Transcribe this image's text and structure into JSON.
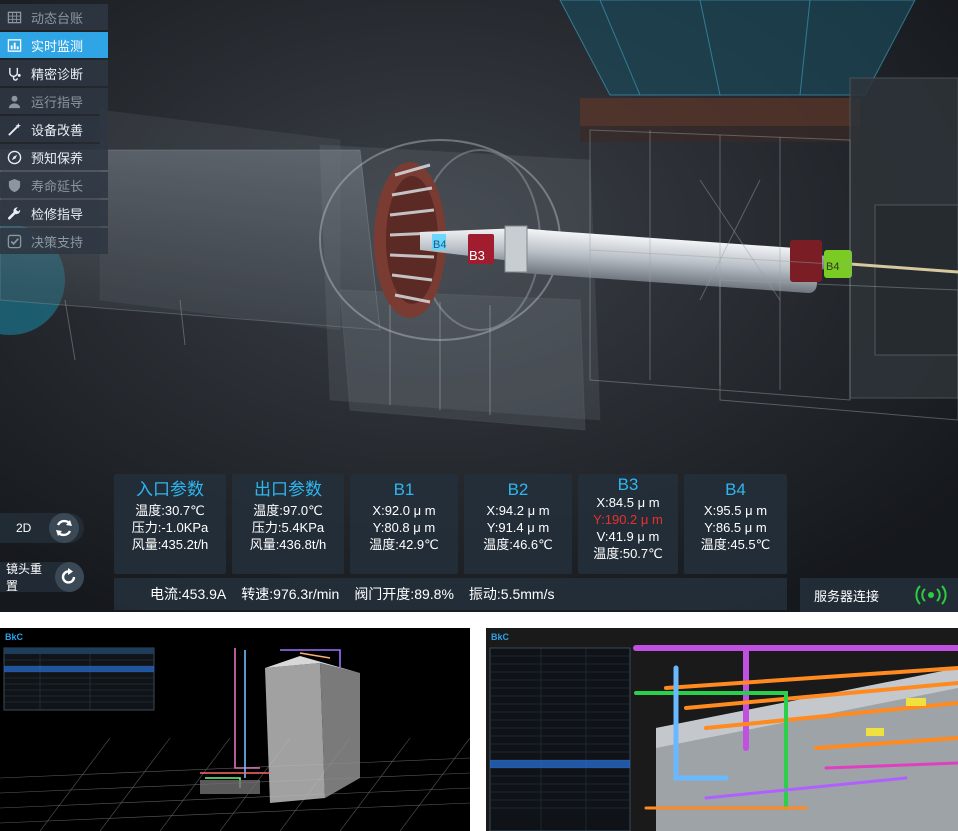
{
  "menu": [
    {
      "label": "动态台账",
      "icon": "table-icon",
      "state": "disabled"
    },
    {
      "label": "实时监测",
      "icon": "bar-chart-icon",
      "state": "active"
    },
    {
      "label": "精密诊断",
      "icon": "stethoscope-icon",
      "state": "normal"
    },
    {
      "label": "运行指导",
      "icon": "user-icon",
      "state": "disabled"
    },
    {
      "label": "设备改善",
      "icon": "magic-wand-icon",
      "state": "normal"
    },
    {
      "label": "预知保养",
      "icon": "compass-icon",
      "state": "normal"
    },
    {
      "label": "寿命延长",
      "icon": "shield-icon",
      "state": "disabled"
    },
    {
      "label": "检修指导",
      "icon": "wrench-icon",
      "state": "normal"
    },
    {
      "label": "决策支持",
      "icon": "checkbox-icon",
      "state": "disabled"
    }
  ],
  "scene_labels": {
    "b3": "B3",
    "b4_left": "B4",
    "b4_right": "B4"
  },
  "controls": {
    "mode_label": "2D",
    "reset_label": "镜头重置"
  },
  "panels": {
    "inlet": {
      "title": "入口参数",
      "lines": [
        "温度:30.7℃",
        "压力:-1.0KPa",
        "风量:435.2t/h"
      ]
    },
    "outlet": {
      "title": "出口参数",
      "lines": [
        "温度:97.0℃",
        "压力:5.4KPa",
        "风量:436.8t/h"
      ]
    },
    "b1": {
      "title": "B1",
      "lines": [
        "X:92.0 μ m",
        "Y:80.8 μ m",
        "温度:42.9℃"
      ]
    },
    "b2": {
      "title": "B2",
      "lines": [
        "X:94.2 μ m",
        "Y:91.4 μ m",
        "温度:46.6℃"
      ]
    },
    "b3": {
      "title": "B3",
      "lines": [
        "X:84.5 μ m",
        "Y:190.2 μ m",
        "V:41.9 μ m",
        "温度:50.7℃"
      ],
      "alert_line": "Y:190.2 μ m"
    },
    "b4": {
      "title": "B4",
      "lines": [
        "X:95.5 μ m",
        "Y:86.5 μ m",
        "温度:45.5℃"
      ]
    }
  },
  "status": {
    "current": "电流:453.9A",
    "speed": "转速:976.3r/min",
    "valve": "阀门开度:89.8%",
    "vibration": "振动:5.5mm/s"
  },
  "server": {
    "label": "服务器连接"
  },
  "thumbnails": {
    "logo_mark": "BkC"
  },
  "colors": {
    "accent": "#2fa5e6",
    "title": "#2fb6f0",
    "alert": "#e8312c",
    "panel": "#242f3a",
    "signal": "#2ecc40"
  }
}
